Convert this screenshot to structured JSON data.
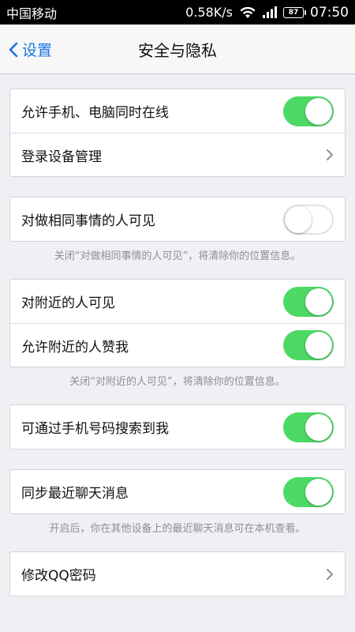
{
  "status_bar": {
    "carrier": "中国移动",
    "speed": "0.58K/s",
    "battery": "87",
    "time": "07:50"
  },
  "nav": {
    "back_label": "设置",
    "title": "安全与隐私"
  },
  "groups": [
    {
      "rows": [
        {
          "label": "允许手机、电脑同时在线",
          "type": "toggle",
          "on": true
        },
        {
          "label": "登录设备管理",
          "type": "chevron"
        }
      ]
    },
    {
      "rows": [
        {
          "label": "对做相同事情的人可见",
          "type": "toggle",
          "on": false
        }
      ],
      "footnote": "关闭“对做相同事情的人可见”，将清除你的位置信息。"
    },
    {
      "rows": [
        {
          "label": "对附近的人可见",
          "type": "toggle",
          "on": true
        },
        {
          "label": "允许附近的人赞我",
          "type": "toggle",
          "on": true
        }
      ],
      "footnote": "关闭“对附近的人可见”，将清除你的位置信息。"
    },
    {
      "rows": [
        {
          "label": "可通过手机号码搜索到我",
          "type": "toggle",
          "on": true
        }
      ]
    },
    {
      "rows": [
        {
          "label": "同步最近聊天消息",
          "type": "toggle",
          "on": true
        }
      ],
      "footnote": "开启后，你在其他设备上的最近聊天消息可在本机查看。"
    },
    {
      "rows": [
        {
          "label": "修改QQ密码",
          "type": "chevron"
        }
      ]
    }
  ],
  "colors": {
    "accent": "#1a73e8",
    "toggle_on": "#4cd964",
    "background": "#efeff4"
  }
}
